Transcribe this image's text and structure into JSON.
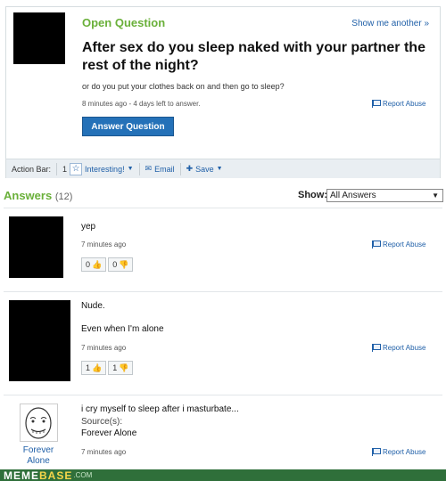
{
  "question": {
    "label": "Open Question",
    "show_another": "Show me another »",
    "title": "After sex do you sleep naked with your partner the rest of the night?",
    "detail": "or do you put your clothes back on and then go to sleep?",
    "meta": "8 minutes ago - 4 days left to answer.",
    "report": "Report Abuse",
    "answer_button": "Answer Question"
  },
  "action_bar": {
    "label": "Action Bar:",
    "count": "1",
    "interesting": "Interesting!",
    "email": "Email",
    "save": "Save"
  },
  "answers": {
    "title": "Answers",
    "count": "(12)",
    "show_label": "Show:",
    "show_value": "All Answers",
    "items": [
      {
        "text": "yep",
        "time": "7 minutes ago",
        "up": "0",
        "down": "0",
        "report": "Report Abuse"
      },
      {
        "text": "Nude.",
        "text2": "Even when I'm alone",
        "time": "7 minutes ago",
        "up": "1",
        "down": "1",
        "report": "Report Abuse"
      },
      {
        "text": "i cry myself to sleep after i masturbate...",
        "source_label": "Source(s):",
        "source": "Forever Alone",
        "user": "Forever Alone",
        "time": "7 minutes ago",
        "report": "Report Abuse"
      }
    ]
  },
  "watermark": {
    "brand_a": "MEME",
    "brand_b": "BASE",
    "tld": ".COM"
  }
}
